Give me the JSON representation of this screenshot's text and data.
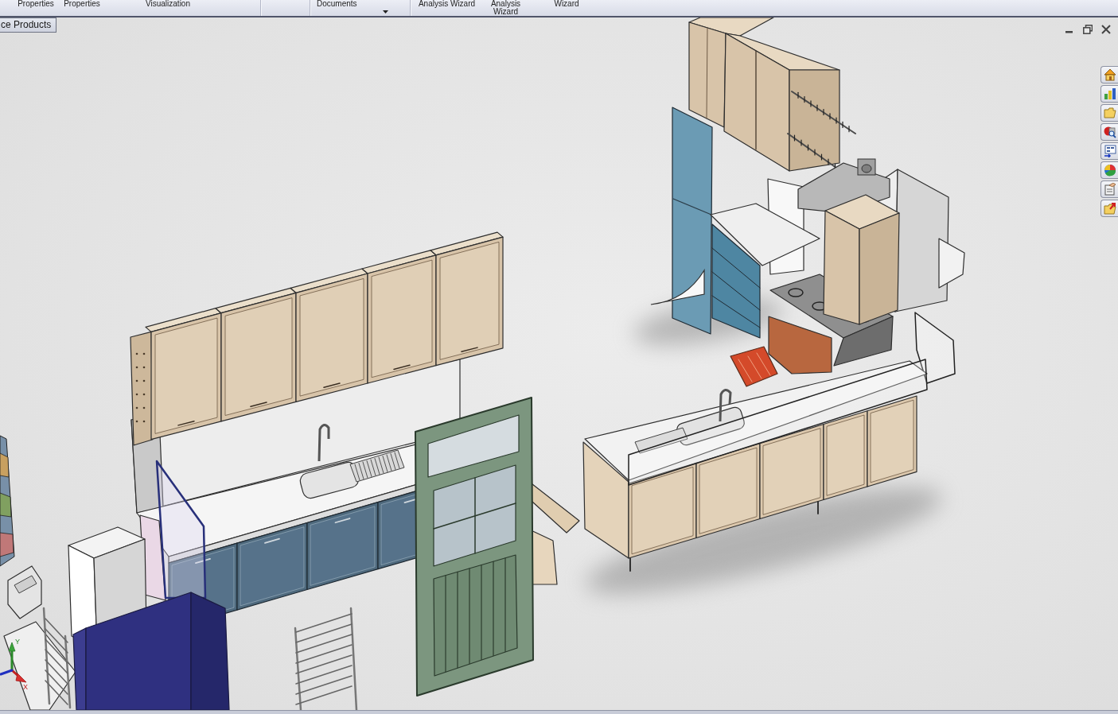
{
  "ribbon": {
    "items": [
      {
        "kind": "button",
        "lines": [
          "Properties"
        ],
        "dropdown": false
      },
      {
        "kind": "button",
        "lines": [
          "Properties"
        ],
        "dropdown": false
      },
      {
        "kind": "button",
        "lines": [
          "Visualization"
        ],
        "dropdown": false
      },
      {
        "kind": "separator"
      },
      {
        "kind": "separator"
      },
      {
        "kind": "button",
        "lines": [
          "Documents"
        ],
        "dropdown": true
      },
      {
        "kind": "separator"
      },
      {
        "kind": "button",
        "lines": [
          "Analysis Wizard"
        ],
        "dropdown": false
      },
      {
        "kind": "button",
        "lines": [
          "Analysis",
          "Wizard"
        ],
        "dropdown": false
      },
      {
        "kind": "button",
        "lines": [
          "Wizard"
        ],
        "dropdown": false
      }
    ]
  },
  "viewport": {
    "tree_tab": "ce Products",
    "triad": {
      "y_label": "Y",
      "x_label": "X"
    }
  }
}
